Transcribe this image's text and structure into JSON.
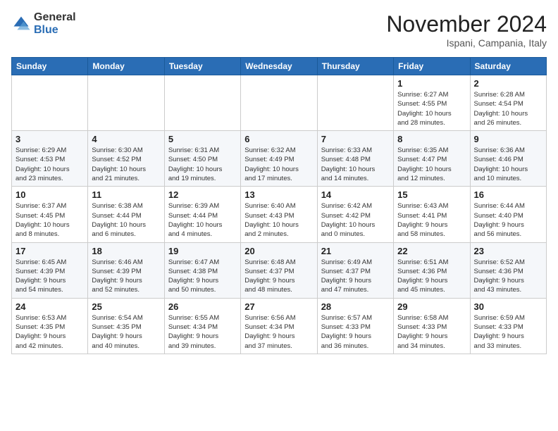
{
  "logo": {
    "general": "General",
    "blue": "Blue"
  },
  "header": {
    "month": "November 2024",
    "location": "Ispani, Campania, Italy"
  },
  "weekdays": [
    "Sunday",
    "Monday",
    "Tuesday",
    "Wednesday",
    "Thursday",
    "Friday",
    "Saturday"
  ],
  "weeks": [
    [
      {
        "day": "",
        "info": ""
      },
      {
        "day": "",
        "info": ""
      },
      {
        "day": "",
        "info": ""
      },
      {
        "day": "",
        "info": ""
      },
      {
        "day": "",
        "info": ""
      },
      {
        "day": "1",
        "info": "Sunrise: 6:27 AM\nSunset: 4:55 PM\nDaylight: 10 hours\nand 28 minutes."
      },
      {
        "day": "2",
        "info": "Sunrise: 6:28 AM\nSunset: 4:54 PM\nDaylight: 10 hours\nand 26 minutes."
      }
    ],
    [
      {
        "day": "3",
        "info": "Sunrise: 6:29 AM\nSunset: 4:53 PM\nDaylight: 10 hours\nand 23 minutes."
      },
      {
        "day": "4",
        "info": "Sunrise: 6:30 AM\nSunset: 4:52 PM\nDaylight: 10 hours\nand 21 minutes."
      },
      {
        "day": "5",
        "info": "Sunrise: 6:31 AM\nSunset: 4:50 PM\nDaylight: 10 hours\nand 19 minutes."
      },
      {
        "day": "6",
        "info": "Sunrise: 6:32 AM\nSunset: 4:49 PM\nDaylight: 10 hours\nand 17 minutes."
      },
      {
        "day": "7",
        "info": "Sunrise: 6:33 AM\nSunset: 4:48 PM\nDaylight: 10 hours\nand 14 minutes."
      },
      {
        "day": "8",
        "info": "Sunrise: 6:35 AM\nSunset: 4:47 PM\nDaylight: 10 hours\nand 12 minutes."
      },
      {
        "day": "9",
        "info": "Sunrise: 6:36 AM\nSunset: 4:46 PM\nDaylight: 10 hours\nand 10 minutes."
      }
    ],
    [
      {
        "day": "10",
        "info": "Sunrise: 6:37 AM\nSunset: 4:45 PM\nDaylight: 10 hours\nand 8 minutes."
      },
      {
        "day": "11",
        "info": "Sunrise: 6:38 AM\nSunset: 4:44 PM\nDaylight: 10 hours\nand 6 minutes."
      },
      {
        "day": "12",
        "info": "Sunrise: 6:39 AM\nSunset: 4:44 PM\nDaylight: 10 hours\nand 4 minutes."
      },
      {
        "day": "13",
        "info": "Sunrise: 6:40 AM\nSunset: 4:43 PM\nDaylight: 10 hours\nand 2 minutes."
      },
      {
        "day": "14",
        "info": "Sunrise: 6:42 AM\nSunset: 4:42 PM\nDaylight: 10 hours\nand 0 minutes."
      },
      {
        "day": "15",
        "info": "Sunrise: 6:43 AM\nSunset: 4:41 PM\nDaylight: 9 hours\nand 58 minutes."
      },
      {
        "day": "16",
        "info": "Sunrise: 6:44 AM\nSunset: 4:40 PM\nDaylight: 9 hours\nand 56 minutes."
      }
    ],
    [
      {
        "day": "17",
        "info": "Sunrise: 6:45 AM\nSunset: 4:39 PM\nDaylight: 9 hours\nand 54 minutes."
      },
      {
        "day": "18",
        "info": "Sunrise: 6:46 AM\nSunset: 4:39 PM\nDaylight: 9 hours\nand 52 minutes."
      },
      {
        "day": "19",
        "info": "Sunrise: 6:47 AM\nSunset: 4:38 PM\nDaylight: 9 hours\nand 50 minutes."
      },
      {
        "day": "20",
        "info": "Sunrise: 6:48 AM\nSunset: 4:37 PM\nDaylight: 9 hours\nand 48 minutes."
      },
      {
        "day": "21",
        "info": "Sunrise: 6:49 AM\nSunset: 4:37 PM\nDaylight: 9 hours\nand 47 minutes."
      },
      {
        "day": "22",
        "info": "Sunrise: 6:51 AM\nSunset: 4:36 PM\nDaylight: 9 hours\nand 45 minutes."
      },
      {
        "day": "23",
        "info": "Sunrise: 6:52 AM\nSunset: 4:36 PM\nDaylight: 9 hours\nand 43 minutes."
      }
    ],
    [
      {
        "day": "24",
        "info": "Sunrise: 6:53 AM\nSunset: 4:35 PM\nDaylight: 9 hours\nand 42 minutes."
      },
      {
        "day": "25",
        "info": "Sunrise: 6:54 AM\nSunset: 4:35 PM\nDaylight: 9 hours\nand 40 minutes."
      },
      {
        "day": "26",
        "info": "Sunrise: 6:55 AM\nSunset: 4:34 PM\nDaylight: 9 hours\nand 39 minutes."
      },
      {
        "day": "27",
        "info": "Sunrise: 6:56 AM\nSunset: 4:34 PM\nDaylight: 9 hours\nand 37 minutes."
      },
      {
        "day": "28",
        "info": "Sunrise: 6:57 AM\nSunset: 4:33 PM\nDaylight: 9 hours\nand 36 minutes."
      },
      {
        "day": "29",
        "info": "Sunrise: 6:58 AM\nSunset: 4:33 PM\nDaylight: 9 hours\nand 34 minutes."
      },
      {
        "day": "30",
        "info": "Sunrise: 6:59 AM\nSunset: 4:33 PM\nDaylight: 9 hours\nand 33 minutes."
      }
    ]
  ]
}
